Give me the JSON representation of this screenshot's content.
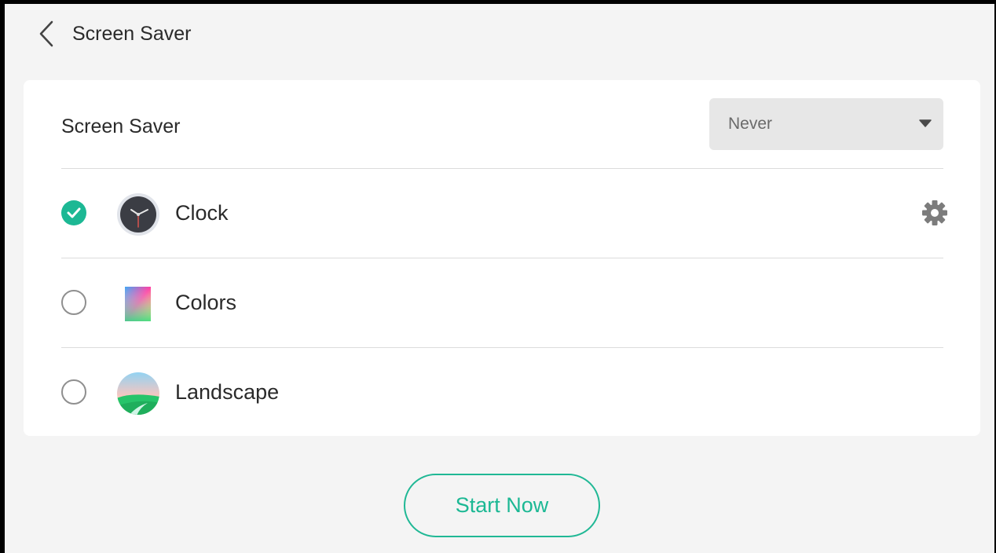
{
  "header": {
    "title": "Screen Saver",
    "back_icon": "chevron-left-icon"
  },
  "settings": {
    "label": "Screen Saver",
    "dropdown_value": "Never",
    "dropdown_icon": "caret-down-icon"
  },
  "items": [
    {
      "label": "Clock",
      "icon": "clock-icon",
      "selected": true,
      "has_settings": true,
      "settings_icon": "gear-icon"
    },
    {
      "label": "Colors",
      "icon": "colors-gradient-icon",
      "selected": false,
      "has_settings": false
    },
    {
      "label": "Landscape",
      "icon": "landscape-icon",
      "selected": false,
      "has_settings": false
    }
  ],
  "actions": {
    "start_label": "Start Now"
  },
  "colors": {
    "accent": "#1cb894",
    "background": "#f4f4f4",
    "card": "#ffffff",
    "dropdown_bg": "#e7e7e7"
  }
}
